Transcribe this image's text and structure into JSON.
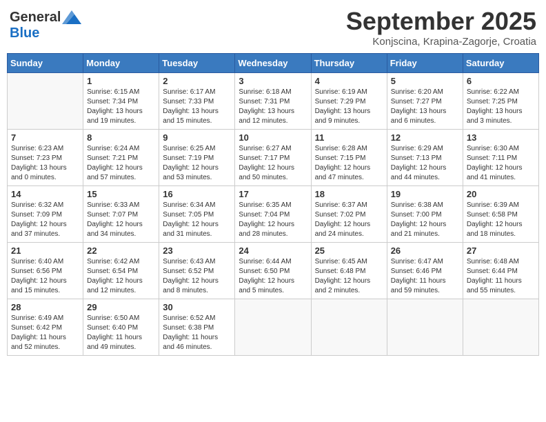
{
  "header": {
    "logo_general": "General",
    "logo_blue": "Blue",
    "month_title": "September 2025",
    "location": "Konjscina, Krapina-Zagorje, Croatia"
  },
  "weekdays": [
    "Sunday",
    "Monday",
    "Tuesday",
    "Wednesday",
    "Thursday",
    "Friday",
    "Saturday"
  ],
  "weeks": [
    [
      {
        "day": "",
        "info": ""
      },
      {
        "day": "1",
        "info": "Sunrise: 6:15 AM\nSunset: 7:34 PM\nDaylight: 13 hours\nand 19 minutes."
      },
      {
        "day": "2",
        "info": "Sunrise: 6:17 AM\nSunset: 7:33 PM\nDaylight: 13 hours\nand 15 minutes."
      },
      {
        "day": "3",
        "info": "Sunrise: 6:18 AM\nSunset: 7:31 PM\nDaylight: 13 hours\nand 12 minutes."
      },
      {
        "day": "4",
        "info": "Sunrise: 6:19 AM\nSunset: 7:29 PM\nDaylight: 13 hours\nand 9 minutes."
      },
      {
        "day": "5",
        "info": "Sunrise: 6:20 AM\nSunset: 7:27 PM\nDaylight: 13 hours\nand 6 minutes."
      },
      {
        "day": "6",
        "info": "Sunrise: 6:22 AM\nSunset: 7:25 PM\nDaylight: 13 hours\nand 3 minutes."
      }
    ],
    [
      {
        "day": "7",
        "info": "Sunrise: 6:23 AM\nSunset: 7:23 PM\nDaylight: 13 hours\nand 0 minutes."
      },
      {
        "day": "8",
        "info": "Sunrise: 6:24 AM\nSunset: 7:21 PM\nDaylight: 12 hours\nand 57 minutes."
      },
      {
        "day": "9",
        "info": "Sunrise: 6:25 AM\nSunset: 7:19 PM\nDaylight: 12 hours\nand 53 minutes."
      },
      {
        "day": "10",
        "info": "Sunrise: 6:27 AM\nSunset: 7:17 PM\nDaylight: 12 hours\nand 50 minutes."
      },
      {
        "day": "11",
        "info": "Sunrise: 6:28 AM\nSunset: 7:15 PM\nDaylight: 12 hours\nand 47 minutes."
      },
      {
        "day": "12",
        "info": "Sunrise: 6:29 AM\nSunset: 7:13 PM\nDaylight: 12 hours\nand 44 minutes."
      },
      {
        "day": "13",
        "info": "Sunrise: 6:30 AM\nSunset: 7:11 PM\nDaylight: 12 hours\nand 41 minutes."
      }
    ],
    [
      {
        "day": "14",
        "info": "Sunrise: 6:32 AM\nSunset: 7:09 PM\nDaylight: 12 hours\nand 37 minutes."
      },
      {
        "day": "15",
        "info": "Sunrise: 6:33 AM\nSunset: 7:07 PM\nDaylight: 12 hours\nand 34 minutes."
      },
      {
        "day": "16",
        "info": "Sunrise: 6:34 AM\nSunset: 7:05 PM\nDaylight: 12 hours\nand 31 minutes."
      },
      {
        "day": "17",
        "info": "Sunrise: 6:35 AM\nSunset: 7:04 PM\nDaylight: 12 hours\nand 28 minutes."
      },
      {
        "day": "18",
        "info": "Sunrise: 6:37 AM\nSunset: 7:02 PM\nDaylight: 12 hours\nand 24 minutes."
      },
      {
        "day": "19",
        "info": "Sunrise: 6:38 AM\nSunset: 7:00 PM\nDaylight: 12 hours\nand 21 minutes."
      },
      {
        "day": "20",
        "info": "Sunrise: 6:39 AM\nSunset: 6:58 PM\nDaylight: 12 hours\nand 18 minutes."
      }
    ],
    [
      {
        "day": "21",
        "info": "Sunrise: 6:40 AM\nSunset: 6:56 PM\nDaylight: 12 hours\nand 15 minutes."
      },
      {
        "day": "22",
        "info": "Sunrise: 6:42 AM\nSunset: 6:54 PM\nDaylight: 12 hours\nand 12 minutes."
      },
      {
        "day": "23",
        "info": "Sunrise: 6:43 AM\nSunset: 6:52 PM\nDaylight: 12 hours\nand 8 minutes."
      },
      {
        "day": "24",
        "info": "Sunrise: 6:44 AM\nSunset: 6:50 PM\nDaylight: 12 hours\nand 5 minutes."
      },
      {
        "day": "25",
        "info": "Sunrise: 6:45 AM\nSunset: 6:48 PM\nDaylight: 12 hours\nand 2 minutes."
      },
      {
        "day": "26",
        "info": "Sunrise: 6:47 AM\nSunset: 6:46 PM\nDaylight: 11 hours\nand 59 minutes."
      },
      {
        "day": "27",
        "info": "Sunrise: 6:48 AM\nSunset: 6:44 PM\nDaylight: 11 hours\nand 55 minutes."
      }
    ],
    [
      {
        "day": "28",
        "info": "Sunrise: 6:49 AM\nSunset: 6:42 PM\nDaylight: 11 hours\nand 52 minutes."
      },
      {
        "day": "29",
        "info": "Sunrise: 6:50 AM\nSunset: 6:40 PM\nDaylight: 11 hours\nand 49 minutes."
      },
      {
        "day": "30",
        "info": "Sunrise: 6:52 AM\nSunset: 6:38 PM\nDaylight: 11 hours\nand 46 minutes."
      },
      {
        "day": "",
        "info": ""
      },
      {
        "day": "",
        "info": ""
      },
      {
        "day": "",
        "info": ""
      },
      {
        "day": "",
        "info": ""
      }
    ]
  ]
}
